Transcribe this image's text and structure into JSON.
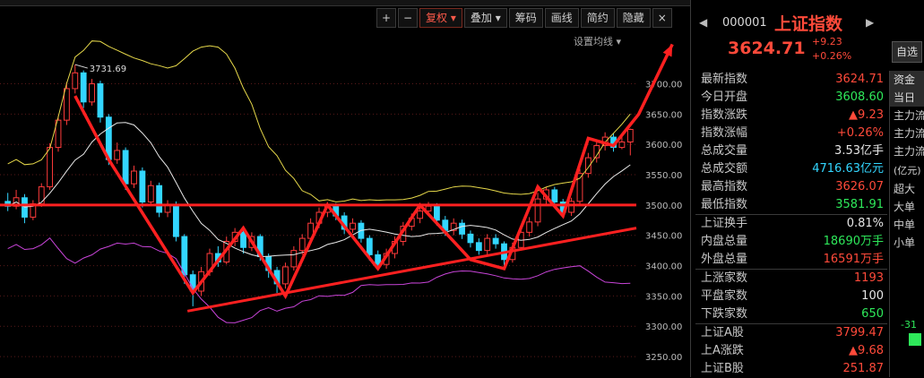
{
  "toolbar": {
    "zoom_in": "+",
    "zoom_out": "−",
    "fuquan": "复权",
    "diejia": "叠加",
    "chouma": "筹码",
    "huaxian": "画线",
    "jieyue": "简约",
    "yincang": "隐藏",
    "close": "×",
    "settings_ma": "设置均线"
  },
  "quote": {
    "code": "000001",
    "name": "上证指数",
    "price": "3624.71",
    "change": "+9.23",
    "change_pct": "+0.26%",
    "auto_btn": "自选",
    "rows_a": [
      {
        "label": "最新指数",
        "value": "3624.71",
        "color": "red"
      },
      {
        "label": "今日开盘",
        "value": "3608.60",
        "color": "green"
      },
      {
        "label": "指数涨跌",
        "value": "▲9.23",
        "color": "red"
      },
      {
        "label": "指数涨幅",
        "value": "+0.26%",
        "color": "red"
      },
      {
        "label": "总成交量",
        "value": "3.53亿手",
        "color": "white"
      },
      {
        "label": "总成交额",
        "value": "4716.63亿元",
        "color": "cyan"
      },
      {
        "label": "最高指数",
        "value": "3626.07",
        "color": "red"
      },
      {
        "label": "最低指数",
        "value": "3581.91",
        "color": "green"
      }
    ],
    "rows_b": [
      {
        "label": "上证换手",
        "value": "0.81%",
        "color": "white"
      },
      {
        "label": "内盘总量",
        "value": "18690万手",
        "color": "green"
      },
      {
        "label": "外盘总量",
        "value": "16591万手",
        "color": "red"
      }
    ],
    "rows_c": [
      {
        "label": "上涨家数",
        "value": "1193",
        "color": "red"
      },
      {
        "label": "平盘家数",
        "value": "100",
        "color": "white"
      },
      {
        "label": "下跌家数",
        "value": "650",
        "color": "green"
      }
    ],
    "rows_d": [
      {
        "label": "上证A股",
        "value": "3799.47",
        "color": "red"
      },
      {
        "label": "上A涨跌",
        "value": "▲9.68",
        "color": "red"
      },
      {
        "label": "上证B股",
        "value": "251.87",
        "color": "red"
      }
    ]
  },
  "side": {
    "tab1": "资金",
    "tab2": "当日",
    "items": [
      "主力流",
      "主力流",
      "主力流"
    ],
    "unit": "(亿元)",
    "items2": [
      "超大",
      "大单",
      "中单",
      "小单"
    ],
    "val": "-31"
  },
  "chart_data": {
    "type": "candlestick",
    "y_ticks": [
      "3700.00",
      "3650.00",
      "3600.00",
      "3550.00",
      "3500.00",
      "3450.00",
      "3400.00",
      "3350.00",
      "3300.00",
      "3250.00"
    ],
    "ylim": [
      3225,
      3785
    ],
    "high_label": "3731.69",
    "support_level": 3500,
    "colors": {
      "up": "#ff3b3b",
      "down": "#33d6ff",
      "ma_white": "#e8e8e8",
      "ma_yellow": "#e6d84a",
      "ma_magenta": "#c844d8",
      "overlay": "#ff2020"
    },
    "candles": [
      [
        3506,
        3498,
        3520,
        3490
      ],
      [
        3498,
        3512,
        3525,
        3493
      ],
      [
        3512,
        3480,
        3518,
        3470
      ],
      [
        3480,
        3502,
        3508,
        3475
      ],
      [
        3502,
        3530,
        3536,
        3497
      ],
      [
        3530,
        3595,
        3602,
        3525
      ],
      [
        3595,
        3640,
        3648,
        3588
      ],
      [
        3640,
        3692,
        3703,
        3632
      ],
      [
        3692,
        3718,
        3731.69,
        3684
      ],
      [
        3718,
        3670,
        3722,
        3660
      ],
      [
        3670,
        3700,
        3708,
        3664
      ],
      [
        3700,
        3645,
        3705,
        3636
      ],
      [
        3645,
        3575,
        3650,
        3566
      ],
      [
        3575,
        3590,
        3603,
        3568
      ],
      [
        3590,
        3535,
        3595,
        3525
      ],
      [
        3535,
        3556,
        3565,
        3528
      ],
      [
        3556,
        3505,
        3562,
        3496
      ],
      [
        3505,
        3532,
        3540,
        3498
      ],
      [
        3532,
        3488,
        3537,
        3480
      ],
      [
        3488,
        3500,
        3508,
        3480
      ],
      [
        3500,
        3448,
        3506,
        3440
      ],
      [
        3448,
        3385,
        3452,
        3370
      ],
      [
        3385,
        3358,
        3392,
        3333
      ],
      [
        3358,
        3390,
        3398,
        3350
      ],
      [
        3390,
        3420,
        3428,
        3383
      ],
      [
        3420,
        3406,
        3432,
        3398
      ],
      [
        3406,
        3440,
        3448,
        3402
      ],
      [
        3440,
        3455,
        3462,
        3432
      ],
      [
        3455,
        3430,
        3460,
        3420
      ],
      [
        3430,
        3448,
        3455,
        3424
      ],
      [
        3448,
        3415,
        3452,
        3408
      ],
      [
        3415,
        3392,
        3420,
        3380
      ],
      [
        3392,
        3370,
        3398,
        3355
      ],
      [
        3370,
        3398,
        3405,
        3362
      ],
      [
        3398,
        3425,
        3432,
        3392
      ],
      [
        3425,
        3445,
        3452,
        3418
      ],
      [
        3445,
        3470,
        3478,
        3438
      ],
      [
        3470,
        3488,
        3496,
        3462
      ],
      [
        3488,
        3498,
        3505,
        3480
      ],
      [
        3498,
        3482,
        3503,
        3475
      ],
      [
        3482,
        3460,
        3488,
        3452
      ],
      [
        3460,
        3470,
        3478,
        3454
      ],
      [
        3470,
        3445,
        3475,
        3438
      ],
      [
        3445,
        3418,
        3450,
        3408
      ],
      [
        3418,
        3402,
        3425,
        3392
      ],
      [
        3402,
        3420,
        3428,
        3395
      ],
      [
        3420,
        3440,
        3448,
        3412
      ],
      [
        3440,
        3465,
        3472,
        3433
      ],
      [
        3465,
        3478,
        3486,
        3458
      ],
      [
        3478,
        3490,
        3498,
        3470
      ],
      [
        3490,
        3498,
        3505,
        3483
      ],
      [
        3498,
        3475,
        3503,
        3466
      ],
      [
        3475,
        3458,
        3482,
        3449
      ],
      [
        3458,
        3470,
        3478,
        3450
      ],
      [
        3470,
        3452,
        3476,
        3444
      ],
      [
        3452,
        3438,
        3458,
        3430
      ],
      [
        3438,
        3425,
        3445,
        3418
      ],
      [
        3425,
        3445,
        3452,
        3418
      ],
      [
        3445,
        3436,
        3452,
        3428
      ],
      [
        3436,
        3410,
        3440,
        3398
      ],
      [
        3410,
        3430,
        3438,
        3405
      ],
      [
        3430,
        3455,
        3462,
        3425
      ],
      [
        3455,
        3472,
        3480,
        3448
      ],
      [
        3472,
        3510,
        3520,
        3465
      ],
      [
        3510,
        3525,
        3530,
        3500
      ],
      [
        3525,
        3505,
        3530,
        3495
      ],
      [
        3505,
        3488,
        3510,
        3480
      ],
      [
        3488,
        3506,
        3512,
        3482
      ],
      [
        3506,
        3552,
        3560,
        3500
      ],
      [
        3552,
        3578,
        3586,
        3545
      ],
      [
        3578,
        3598,
        3605,
        3570
      ],
      [
        3598,
        3612,
        3620,
        3590
      ],
      [
        3612,
        3595,
        3618,
        3588
      ],
      [
        3595,
        3604,
        3612,
        3592
      ],
      [
        3604,
        3624.71,
        3626.07,
        3581.91
      ]
    ]
  }
}
